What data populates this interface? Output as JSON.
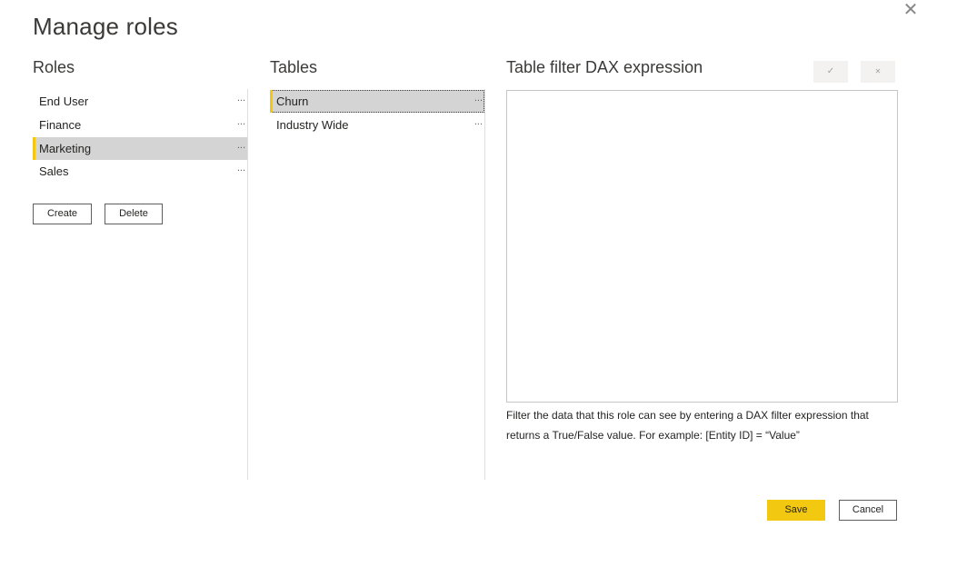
{
  "dialog": {
    "title": "Manage roles",
    "close_glyph": "✕"
  },
  "roles": {
    "heading": "Roles",
    "items": [
      {
        "label": "End User",
        "more": "..."
      },
      {
        "label": "Finance",
        "more": "..."
      },
      {
        "label": "Marketing",
        "more": "...",
        "selected": true
      },
      {
        "label": "Sales",
        "more": "..."
      }
    ],
    "create_label": "Create",
    "delete_label": "Delete"
  },
  "tables": {
    "heading": "Tables",
    "items": [
      {
        "label": "Churn",
        "more": "...",
        "selected": true
      },
      {
        "label": "Industry Wide",
        "more": "..."
      }
    ]
  },
  "filter": {
    "heading": "Table filter DAX expression",
    "accept_glyph": "✓",
    "discard_glyph": "✕",
    "expression": "",
    "help_text": "Filter the data that this role can see by entering a DAX filter expression that returns a True/False value. For example: [Entity ID] = “Value”"
  },
  "footer": {
    "save_label": "Save",
    "cancel_label": "Cancel"
  },
  "colors": {
    "accent": "#f2c811",
    "selection": "#d4d4d4"
  }
}
